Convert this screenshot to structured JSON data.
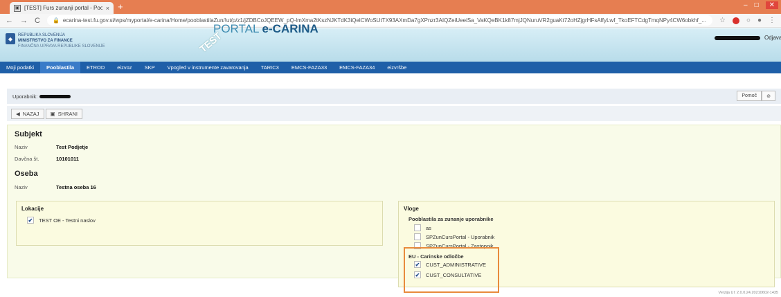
{
  "browser": {
    "tab_title": "[TEST] Furs zunanji portal - Pooli",
    "tab_close": "×",
    "new_tab": "+",
    "url": "ecarina-test.fu.gov.si/wps/myportal/e-carina/Home/pooblastilaZun/!ut/p/z1/jZDBCoJQEEW_pQ-lmXma2tKszNJKTdK3iQelCWoSUtTX93AXmDa7gXPnzr3AIQZeiUeeiSa_VaKQeBK1k87mjJQNuruVR2guaKt72oHZjgrHFsAffyLwf_TkoEFTCdgTmqNPy4CW6obkhf_...",
    "winctrls": [
      "–",
      "□",
      "✕"
    ]
  },
  "header": {
    "ministry_line1": "REPUBLIKA SLOVENIJA",
    "ministry_line2": "MINISTRSTVO ZA FINANCE",
    "ministry_line3": "FINANČNA UPRAVA REPUBLIKE SLOVENIJE",
    "test_stamp": "TEST",
    "portal_title_prefix": "PORTAL ",
    "portal_title_brand": "e-CARINA",
    "logout": "Odjava"
  },
  "nav": [
    {
      "label": "Moji podatki",
      "active": false
    },
    {
      "label": "Pooblastila",
      "active": true
    },
    {
      "label": "ETROD",
      "active": false
    },
    {
      "label": "eizvoz",
      "active": false
    },
    {
      "label": "SKP",
      "active": false
    },
    {
      "label": "Vpogled v instrumente zavarovanja",
      "active": false
    },
    {
      "label": "TARIC3",
      "active": false
    },
    {
      "label": "EMCS-FAZA33",
      "active": false
    },
    {
      "label": "EMCS-FAZA34",
      "active": false
    },
    {
      "label": "eizvršbe",
      "active": false
    }
  ],
  "userbar": {
    "label": "Uporabnik:",
    "help": "Pomoč",
    "settings_icon": "⊘"
  },
  "toolbar": {
    "back": "NAZAJ",
    "save": "SHRANI"
  },
  "subjekt": {
    "title": "Subjekt",
    "naziv_label": "Naziv",
    "naziv_value": "Test Podjetje",
    "davcna_label": "Davčna št.",
    "davcna_value": "10101011"
  },
  "oseba": {
    "title": "Oseba",
    "naziv_label": "Naziv",
    "naziv_value": "Testna oseba 16"
  },
  "lokacije": {
    "title": "Lokacije",
    "items": [
      {
        "label": "TEST OE - Testni naslov",
        "checked": true
      }
    ]
  },
  "vloge": {
    "title": "Vloge",
    "group1_title": "Pooblastila za zunanje uporabnike",
    "group1_items": [
      {
        "label": "as",
        "checked": false
      },
      {
        "label": "SPZunCursPortal - Uporabnik",
        "checked": false
      },
      {
        "label": "SPZunCursPortal - Zastopnik",
        "checked": false
      }
    ],
    "group2_title": "EU - Carinske odločbe",
    "group2_items": [
      {
        "label": "CUST_ADMINISTRATIVE",
        "checked": true
      },
      {
        "label": "CUST_CONSULTATIVE",
        "checked": true
      }
    ]
  },
  "footer": {
    "version": "Verzija UI: 2.0.0.24.20210602-1435"
  },
  "colors": {
    "tabbar": "#e67e51",
    "nav": "#1f5fa8",
    "highlight": "#e88a3c",
    "panel": "#f9fbe9"
  }
}
